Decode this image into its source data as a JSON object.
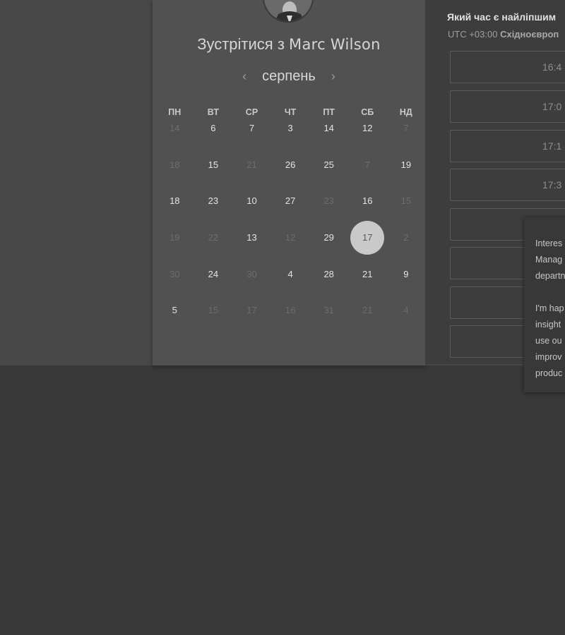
{
  "meeting": {
    "title_prefix": "Зустрітися з",
    "host_name": "Marc Wilson"
  },
  "calendar": {
    "month": "серпень",
    "prev_label": "‹",
    "next_label": "›",
    "weekdays": [
      "ПН",
      "ВТ",
      "СР",
      "ЧТ",
      "ПТ",
      "СБ",
      "НД"
    ],
    "weeks": [
      [
        {
          "d": "14",
          "active": false
        },
        {
          "d": "6",
          "active": true
        },
        {
          "d": "7",
          "active": true
        },
        {
          "d": "3",
          "active": true
        },
        {
          "d": "14",
          "active": true
        },
        {
          "d": "12",
          "active": true
        },
        {
          "d": "7",
          "active": false
        }
      ],
      [
        {
          "d": "18",
          "active": false
        },
        {
          "d": "15",
          "active": true
        },
        {
          "d": "21",
          "active": false
        },
        {
          "d": "26",
          "active": true
        },
        {
          "d": "25",
          "active": true
        },
        {
          "d": "7",
          "active": false
        },
        {
          "d": "19",
          "active": true
        }
      ],
      [
        {
          "d": "18",
          "active": true
        },
        {
          "d": "23",
          "active": true
        },
        {
          "d": "10",
          "active": true
        },
        {
          "d": "27",
          "active": true
        },
        {
          "d": "23",
          "active": false
        },
        {
          "d": "16",
          "active": true
        },
        {
          "d": "15",
          "active": false
        }
      ],
      [
        {
          "d": "19",
          "active": false
        },
        {
          "d": "22",
          "active": false
        },
        {
          "d": "13",
          "active": true
        },
        {
          "d": "12",
          "active": false
        },
        {
          "d": "29",
          "active": true
        },
        {
          "d": "17",
          "active": true,
          "selected": true
        },
        {
          "d": "2",
          "active": false
        }
      ],
      [
        {
          "d": "30",
          "active": false
        },
        {
          "d": "24",
          "active": true
        },
        {
          "d": "30",
          "active": false
        },
        {
          "d": "4",
          "active": true
        },
        {
          "d": "28",
          "active": true
        },
        {
          "d": "21",
          "active": true
        },
        {
          "d": "9",
          "active": true
        }
      ],
      [
        {
          "d": "5",
          "active": true
        },
        {
          "d": "15",
          "active": false
        },
        {
          "d": "17",
          "active": false
        },
        {
          "d": "16",
          "active": false
        },
        {
          "d": "31",
          "active": false
        },
        {
          "d": "21",
          "active": false
        },
        {
          "d": "4",
          "active": false
        }
      ]
    ]
  },
  "times": {
    "title": "Який час є найліпшим",
    "tz_prefix": "UTC +03:00",
    "tz_name": "Східноєвроп",
    "slots": [
      "16:4",
      "17:0",
      "17:1",
      "17:3",
      "",
      "",
      "",
      ""
    ]
  },
  "tooltip": {
    "lines_a": [
      "Interes",
      "Manag",
      "departn"
    ],
    "lines_b": [
      "I'm hap",
      "insight",
      "use ou",
      "improv",
      "produc"
    ]
  },
  "colors": {
    "selected_day_bg": "#c9c9c9",
    "page_bg": "#393939",
    "panel_bg": "#515151"
  }
}
